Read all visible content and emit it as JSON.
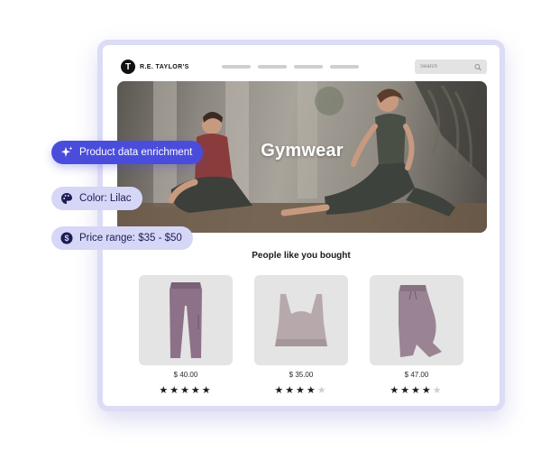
{
  "brand": {
    "name": "R.E. TAYLOR'S",
    "initial": "T"
  },
  "search": {
    "placeholder": "Search"
  },
  "hero": {
    "title": "Gymwear"
  },
  "section": {
    "title": "People like you bought"
  },
  "products": [
    {
      "price": "$ 40.00",
      "rating": 5,
      "max_rating": 5
    },
    {
      "price": "$ 35.00",
      "rating": 4,
      "max_rating": 5
    },
    {
      "price": "$ 47.00",
      "rating": 4,
      "max_rating": 5
    }
  ],
  "pills": {
    "enrichment": {
      "label": "Product data enrichment",
      "icon": "sparkle-icon"
    },
    "color": {
      "label": "Color: Lilac",
      "icon": "palette-icon"
    },
    "price_range": {
      "label": "Price range: $35 - $50",
      "icon": "dollar-icon"
    }
  },
  "colors": {
    "accent": "#4a4ddb",
    "pill_light": "#d6d6f7",
    "frame_border": "#dcdcf6",
    "product_tint": "#9a8494"
  }
}
